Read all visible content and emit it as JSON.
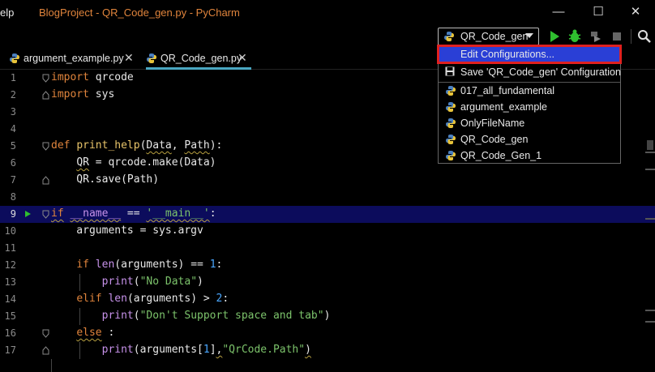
{
  "window": {
    "menu_help": "elp",
    "title": "BlogProject - QR_Code_gen.py - PyCharm",
    "minimize": "—",
    "maximize": "☐",
    "close": "✕"
  },
  "toolbar": {
    "run_config": "QR_Code_gen"
  },
  "tabs": [
    {
      "label": "argument_example.py",
      "close": "✕"
    },
    {
      "label": "QR_Code_gen.py",
      "close": "✕"
    }
  ],
  "menu": {
    "edit": "Edit Configurations...",
    "save": "Save 'QR_Code_gen' Configuration",
    "configs": [
      "017_all_fundamental",
      "argument_example",
      "OnlyFileName",
      "QR_Code_gen",
      "QR_Code_Gen_1"
    ]
  },
  "editor": {
    "line_numbers": [
      "1",
      "2",
      "3",
      "4",
      "5",
      "6",
      "7",
      "8",
      "9",
      "10",
      "11",
      "12",
      "13",
      "14",
      "15",
      "16",
      "17"
    ],
    "current_line": 9
  },
  "colors": {
    "keyword": "#e0843c",
    "function": "#e8c46a",
    "number": "#4aa7ff",
    "string": "#7cc36b",
    "selected_menu": "#2a3fd6",
    "highlight_border": "#e02020",
    "current_line": "#0c0c5c"
  }
}
